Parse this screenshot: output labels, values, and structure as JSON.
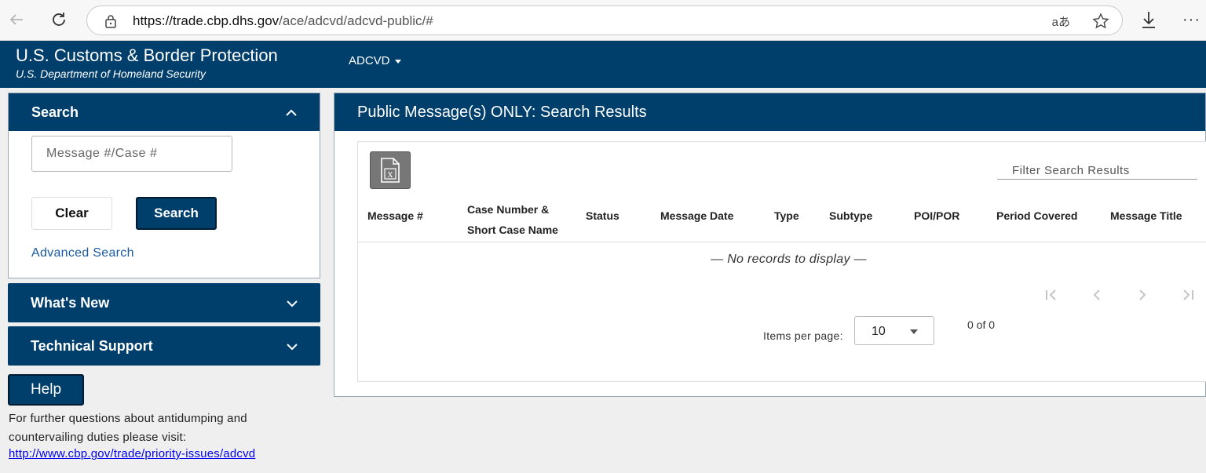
{
  "browser": {
    "url_domain": "https://trade.cbp.dhs.gov",
    "url_path": "/ace/adcvd/adcvd-public/#",
    "read_aloud_label": "aあ"
  },
  "header": {
    "agency": "U.S. Customs & Border Protection",
    "department": "U.S. Department of Homeland Security",
    "nav_adcvd": "ADCVD"
  },
  "sidebar": {
    "search_title": "Search",
    "search_placeholder": "Message #/Case #",
    "clear_label": "Clear",
    "search_label": "Search",
    "advanced_search": "Advanced Search",
    "whats_new": "What's New",
    "technical_support": "Technical Support",
    "help_label": "Help",
    "help_text": "For further questions about antidumping and countervailing duties please visit:",
    "help_link": "http://www.cbp.gov/trade/priority-issues/adcvd"
  },
  "results": {
    "title": "Public Message(s) ONLY: Search Results",
    "filter_placeholder": "Filter Search Results",
    "columns": {
      "message_num": "Message #",
      "case_line1": "Case Number &",
      "case_line2": "Short Case Name",
      "status": "Status",
      "message_date": "Message Date",
      "type": "Type",
      "subtype": "Subtype",
      "poi_por": "POI/POR",
      "period_covered": "Period Covered",
      "message_title": "Message Title"
    },
    "empty_text": "— No records to display —",
    "items_per_page_label": "Items per page:",
    "items_per_page_value": "10",
    "range_label": "0 of 0"
  },
  "colors": {
    "brand_navy": "#003f6b",
    "link_blue": "#1a5aa0"
  }
}
